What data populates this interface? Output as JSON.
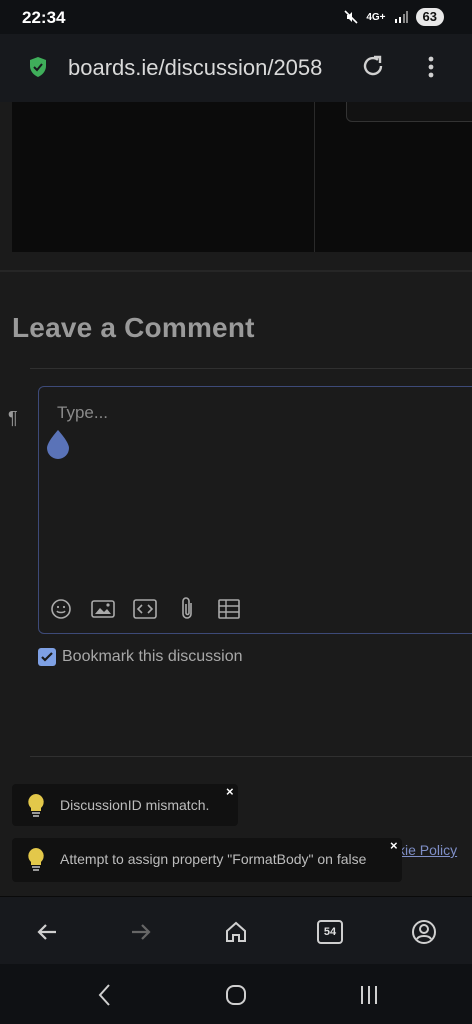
{
  "status_bar": {
    "time": "22:34",
    "network": "4G+",
    "battery": "63"
  },
  "browser": {
    "url": "boards.ie/discussion/2058"
  },
  "comment_section": {
    "title": "Leave a Comment",
    "placeholder": "Type...",
    "paragraph_icon": "¶",
    "toolbar_icons": [
      "emoji-icon",
      "image-icon",
      "code-icon",
      "attachment-icon",
      "table-icon"
    ],
    "bookmark_label": "Bookmark this discussion",
    "bookmark_checked": true
  },
  "footer": {
    "cookie_link": "kie Policy"
  },
  "toasts": [
    {
      "message": "DiscussionID mismatch.",
      "close": "×"
    },
    {
      "message": "Attempt to assign property \"FormatBody\" on false",
      "close": "×"
    }
  ],
  "bottom_nav": {
    "tab_count": "54"
  },
  "colors": {
    "accent": "#7ea0e4",
    "editor_border": "#3d4a78",
    "shield": "#3fae5a",
    "bulb": "#e3c84a"
  }
}
